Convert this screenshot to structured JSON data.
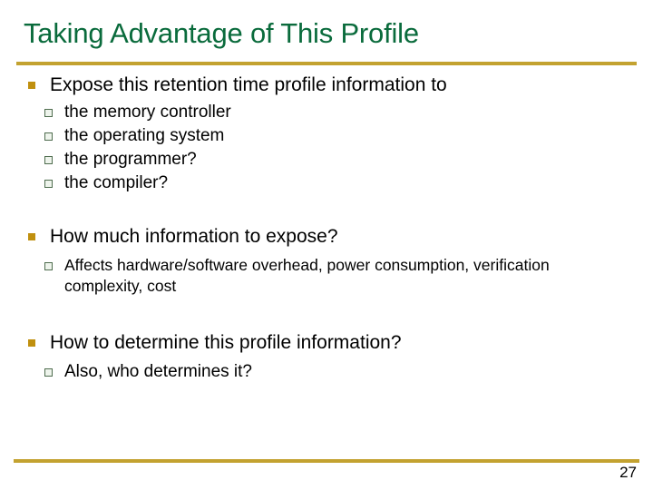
{
  "slide": {
    "title": "Taking Advantage of This Profile",
    "page_number": "27",
    "colors": {
      "title_green": "#0a6b3c",
      "rule_gold": "#c3a230",
      "bullet1_gold": "#c0900f",
      "bullet2_green": "#4e6c4e",
      "body_text": "#000000",
      "background": "#ffffff"
    },
    "groups": [
      {
        "bullet": "Expose this retention time profile information to",
        "sub_bullets": [
          "the memory controller",
          "the operating system",
          "the programmer?",
          "the compiler?"
        ]
      },
      {
        "bullet": "How much information to expose?",
        "sub_bullets": [
          "Affects hardware/software overhead, power consumption, verification complexity, cost"
        ]
      },
      {
        "bullet": "How to determine this profile information?",
        "sub_bullets": [
          "Also, who determines it?"
        ]
      }
    ]
  }
}
